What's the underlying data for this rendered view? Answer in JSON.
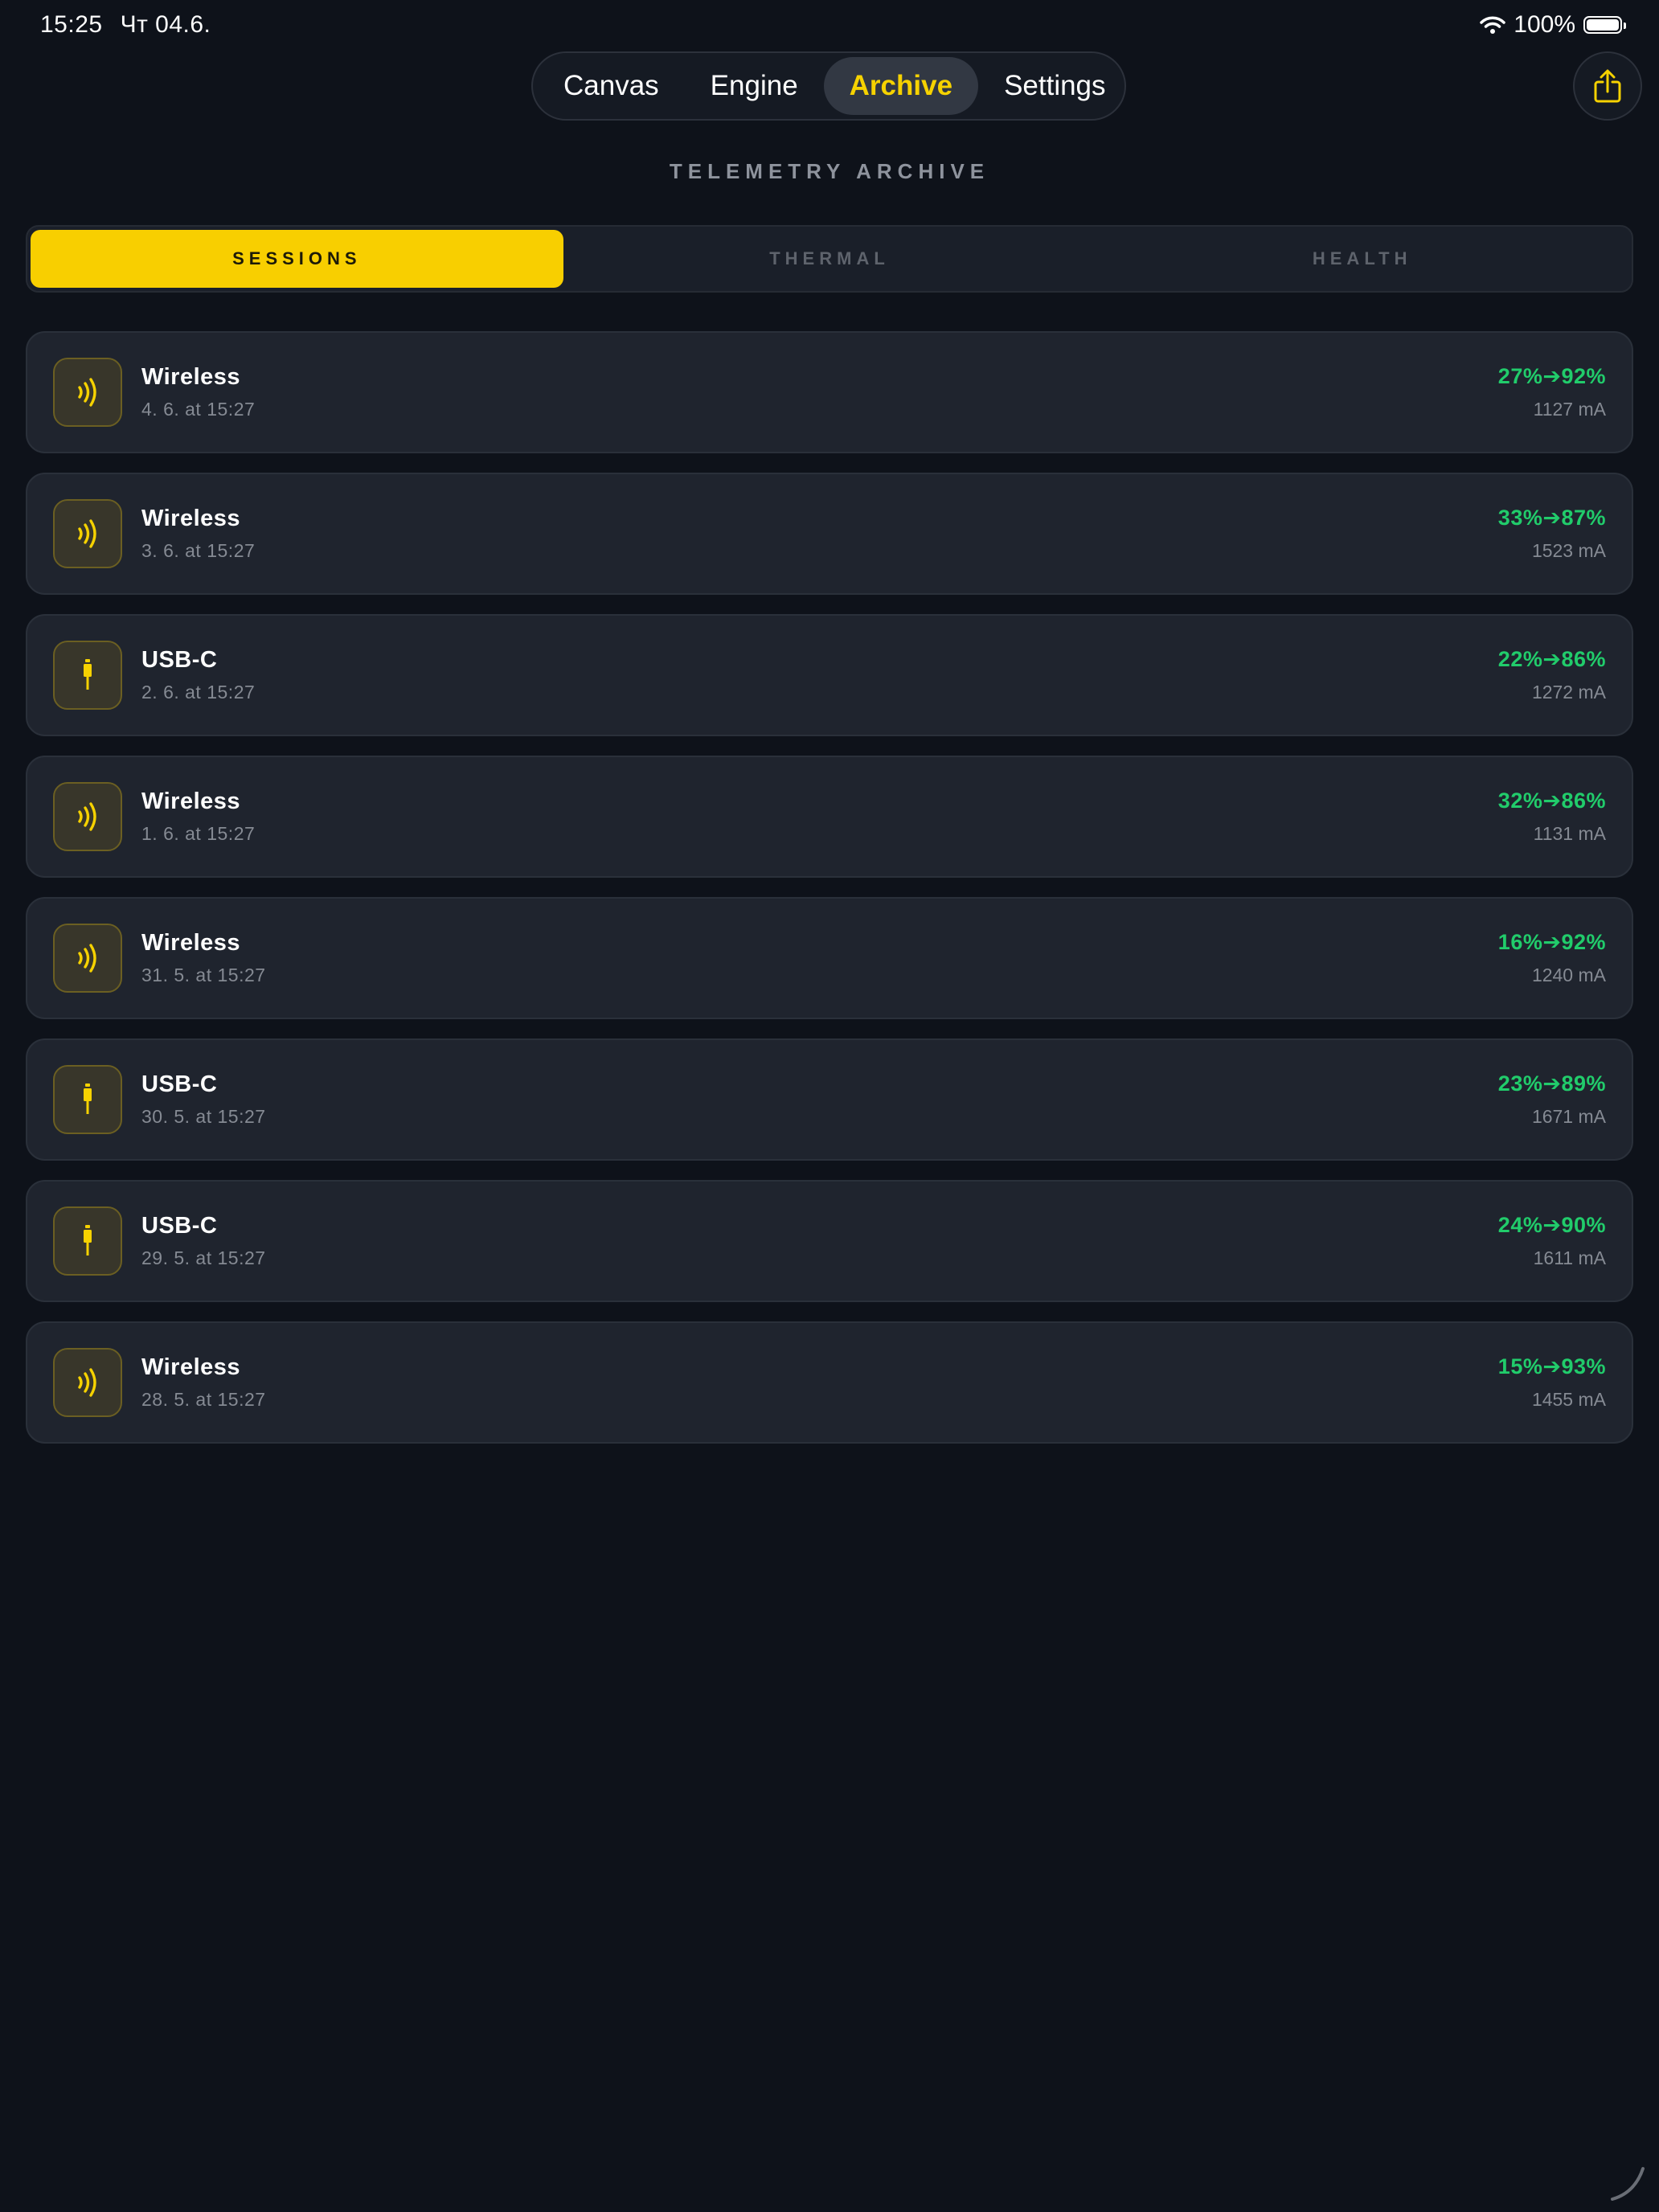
{
  "status_bar": {
    "time": "15:25",
    "date": "Чт 04.6.",
    "battery_text": "100%",
    "battery_level": 1.0
  },
  "nav": {
    "tabs": [
      {
        "label": "Canvas",
        "active": false
      },
      {
        "label": "Engine",
        "active": false
      },
      {
        "label": "Archive",
        "active": true
      },
      {
        "label": "Settings",
        "active": false
      }
    ],
    "share_icon": "share-icon"
  },
  "page_title": "TELEMETRY ARCHIVE",
  "segments": [
    {
      "label": "SESSIONS",
      "active": true
    },
    {
      "label": "THERMAL",
      "active": false
    },
    {
      "label": "HEALTH",
      "active": false
    }
  ],
  "sessions": [
    {
      "type": "Wireless",
      "icon": "wireless-icon",
      "date": "4. 6. at 15:27",
      "charge": "27%➔92%",
      "current": "1127 mA"
    },
    {
      "type": "Wireless",
      "icon": "wireless-icon",
      "date": "3. 6. at 15:27",
      "charge": "33%➔87%",
      "current": "1523 mA"
    },
    {
      "type": "USB-C",
      "icon": "usb-c-icon",
      "date": "2. 6. at 15:27",
      "charge": "22%➔86%",
      "current": "1272 mA"
    },
    {
      "type": "Wireless",
      "icon": "wireless-icon",
      "date": "1. 6. at 15:27",
      "charge": "32%➔86%",
      "current": "1131 mA"
    },
    {
      "type": "Wireless",
      "icon": "wireless-icon",
      "date": "31. 5. at 15:27",
      "charge": "16%➔92%",
      "current": "1240 mA"
    },
    {
      "type": "USB-C",
      "icon": "usb-c-icon",
      "date": "30. 5. at 15:27",
      "charge": "23%➔89%",
      "current": "1671 mA"
    },
    {
      "type": "USB-C",
      "icon": "usb-c-icon",
      "date": "29. 5. at 15:27",
      "charge": "24%➔90%",
      "current": "1611 mA"
    },
    {
      "type": "Wireless",
      "icon": "wireless-icon",
      "date": "28. 5. at 15:27",
      "charge": "15%➔93%",
      "current": "1455 mA"
    }
  ],
  "colors": {
    "accent": "#f8cf00",
    "positive": "#21cc6b",
    "background": "#0e121a",
    "card": "#1f242e"
  }
}
